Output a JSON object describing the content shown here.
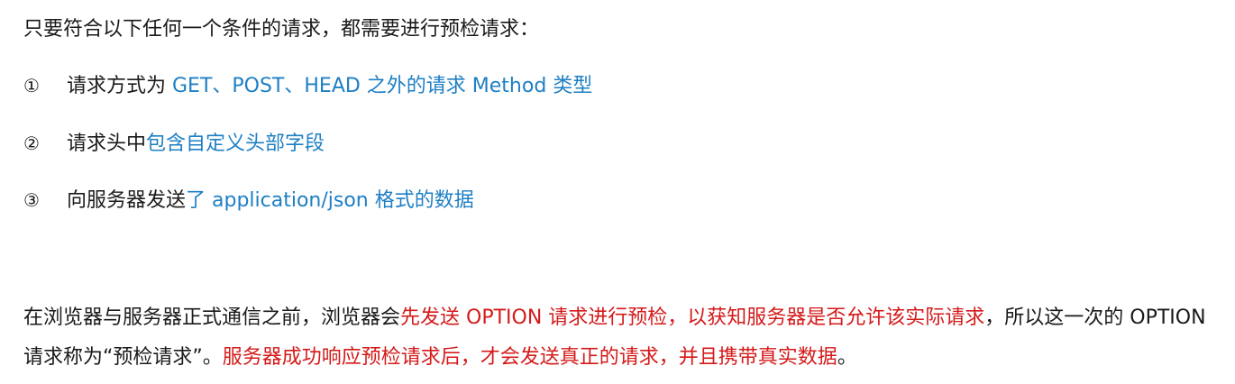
{
  "intro": "只要符合以下任何一个条件的请求，都需要进行预检请求：",
  "items": [
    {
      "number": "①",
      "black": "请求方式为 ",
      "blue": "GET、POST、HEAD 之外的请求 Method 类型"
    },
    {
      "number": "②",
      "black": "请求头中",
      "blue": "包含自定义头部字段"
    },
    {
      "number": "③",
      "black": "向服务器发送",
      "blue": "了 application/json 格式的数据"
    }
  ],
  "paragraph": {
    "part1": "在浏览器与服务器正式通信之前，浏览器会",
    "part2_red": "先发送 OPTION 请求进行预检，以获知服务器是否允许该实际请求",
    "part3": "，所以这一次的 OPTION 请求称为“预检请求”。",
    "part4_red": "服务器成功响应预检请求后，才会发送真正的请求，并且携带真实数据",
    "part5": "。"
  },
  "colors": {
    "text": "#1a1a1a",
    "blue": "#1e7fc4",
    "red": "#d41a1a"
  }
}
